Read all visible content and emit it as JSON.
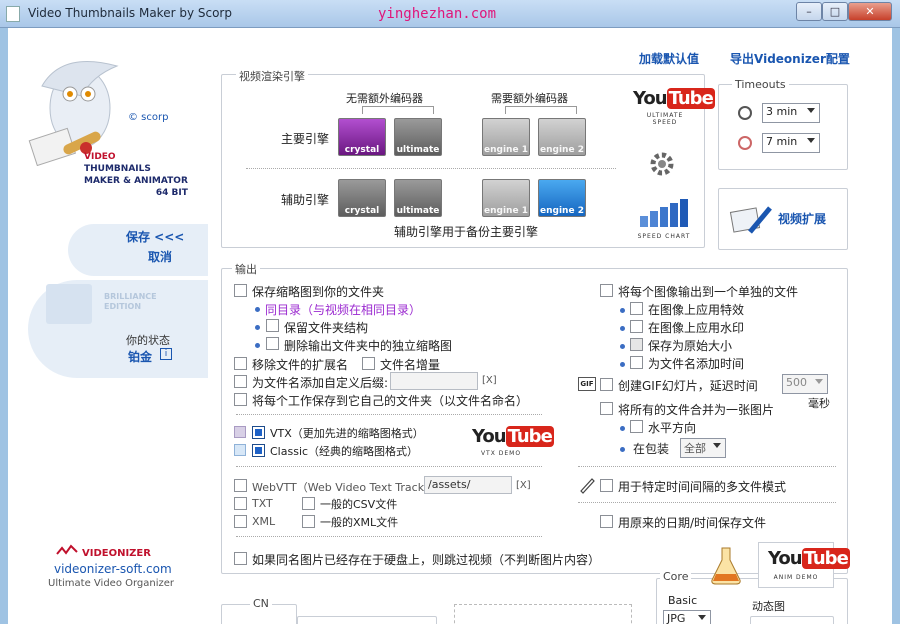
{
  "window": {
    "title": "Video Thumbnails Maker by Scorp",
    "watermark": "yinghezhan.com",
    "min": "–",
    "max": "□",
    "close": "✕"
  },
  "sidebar": {
    "brand_lines": [
      "VIDEO",
      "THUMBNAILS",
      "MAKER & ANIMATOR",
      "64 BIT"
    ],
    "scorp": "© scorp",
    "save": "保存 <<<",
    "cancel": "取消",
    "edition": "BRILLIANCE EDITION",
    "status_label": "你的状态",
    "status_value": "铂金",
    "status_icon": "i",
    "videonizer": "VIDEONIZER",
    "site": "videonizer-soft.com",
    "tagline": "Ultimate Video Organizer"
  },
  "top_links": {
    "load_defaults": "加载默认值",
    "export_videonizer": "导出Videonizer配置"
  },
  "render": {
    "legend": "视频渲染引擎",
    "no_codec": "无需额外编码器",
    "need_codec": "需要额外编码器",
    "primary": "主要引擎",
    "secondary": "辅助引擎",
    "note": "辅助引擎用于备份主要引擎",
    "engines": [
      "crystal",
      "ultimate",
      "engine 1",
      "engine 2"
    ],
    "yt_you": "You",
    "yt_tube": "Tube",
    "ultimate_speed": "ULTIMATE SPEED",
    "speed_chart": "SPEED CHART"
  },
  "timeouts": {
    "legend": "Timeouts",
    "t1": "3 min",
    "t2": "7 min"
  },
  "video_ext": "视频扩展",
  "output": {
    "legend": "输出",
    "save_to_folder": "保存缩略图到你的文件夹",
    "same_dir": "同目录（与视频在相同目录）",
    "keep_structure": "保留文件夹结构",
    "delete_thumbs": "删除输出文件夹中的独立缩略图",
    "remove_ext": "移除文件的扩展名",
    "filename_inc": "文件名增量",
    "add_suffix": "为文件名添加自定义后缀:",
    "suffix_x": "[X]",
    "save_own_folder": "将每个工作保存到它自己的文件夹（以文件名命名）",
    "vtx": "VTX（更加先进的缩略图格式）",
    "classic": "Classic（经典的缩略图格式）",
    "vtx_demo": "VTX DEMO",
    "webvtt": "WebVTT（Web Video Text Tracks）:",
    "webvtt_path": "/assets/",
    "webvtt_x": "[X]",
    "txt": "TXT",
    "xml": "XML",
    "csv": "一般的CSV文件",
    "xmlfile": "一般的XML文件",
    "skip_exist": "如果同名图片已经存在于硬盘上，则跳过视频（不判断图片内容）",
    "each_image": "将每个图像输出到一个单独的文件",
    "apply_effects": "在图像上应用特效",
    "apply_watermark": "在图像上应用水印",
    "keep_size": "保存为原始大小",
    "add_time": "为文件名添加时间",
    "gif": "创建GIF幻灯片，延迟时间",
    "gif_tag": "GIF",
    "gif_delay": "500",
    "ms": "毫秒",
    "merge_all": "将所有的文件合并为一张图片",
    "horizontal": "水平方向",
    "in_pack": "在包装",
    "pack_value": "全部",
    "interval_mode": "用于特定时间间隔的多文件模式",
    "keep_date": "用原来的日期/时间保存文件"
  },
  "core": {
    "legend": "Core",
    "basic": "Basic",
    "format": "JPG",
    "anim": "动态图",
    "anim_demo": "ANIM DEMO"
  },
  "cn_legend": "CN"
}
